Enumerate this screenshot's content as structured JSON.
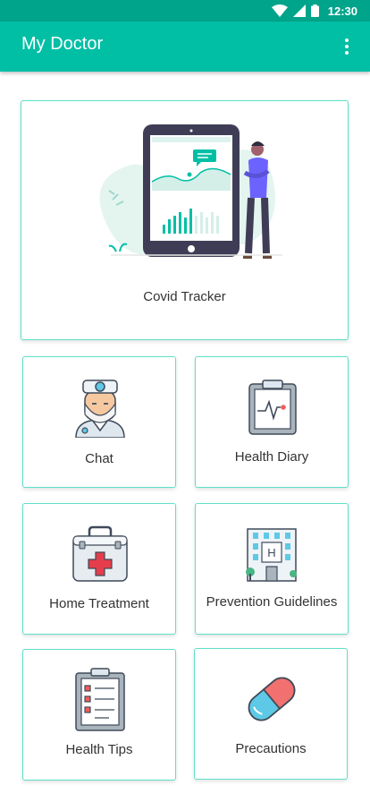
{
  "status_bar": {
    "time": "12:30",
    "icons": [
      "wifi-icon",
      "cellular-signal-icon",
      "battery-icon"
    ]
  },
  "app_bar": {
    "title": "My Doctor",
    "menu_icon": "overflow-menu-icon"
  },
  "menu": {
    "featured": {
      "label": "Covid Tracker",
      "icon": "covid-tracker-illustration"
    },
    "items": [
      {
        "label": "Chat",
        "icon": "doctor-icon"
      },
      {
        "label": "Health Diary",
        "icon": "clipboard-heartbeat-icon"
      },
      {
        "label": "Home Treatment",
        "icon": "first-aid-kit-icon"
      },
      {
        "label": "Prevention Guidelines",
        "icon": "hospital-building-icon"
      },
      {
        "label": "Health Tips",
        "icon": "checklist-icon"
      },
      {
        "label": "Precautions",
        "icon": "pill-capsule-icon"
      }
    ]
  },
  "colors": {
    "primary": "#00bfa5",
    "status_bar": "#00a48a",
    "card_border": "#5fe0c9"
  }
}
